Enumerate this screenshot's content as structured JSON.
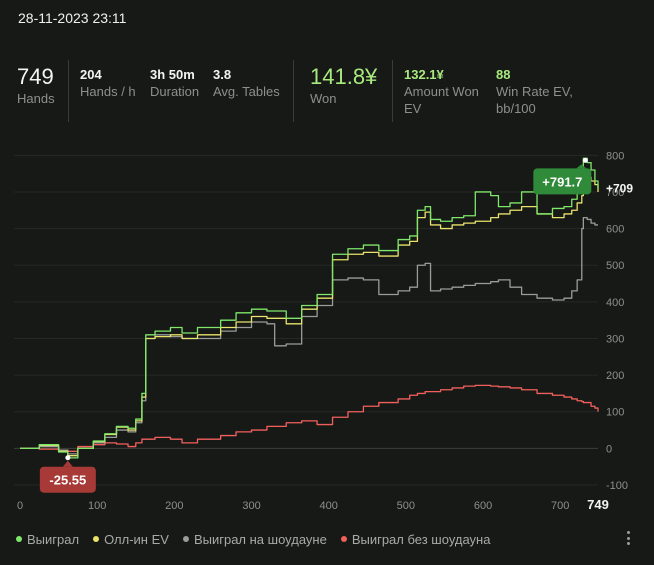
{
  "header": {
    "datetime": "28-11-2023 23:11"
  },
  "stats": {
    "hands": {
      "value": "749",
      "label": "Hands"
    },
    "hands_per_hour": {
      "value": "204",
      "label": "Hands / h"
    },
    "duration": {
      "value": "3h 50m",
      "label": "Duration"
    },
    "avg_tables": {
      "value": "3.8",
      "label": "Avg. Tables"
    },
    "won": {
      "value": "141.8¥",
      "label": "Won"
    },
    "amount_won_ev": {
      "value": "132.1¥",
      "label_line1": "Amount Won",
      "label_line2": "EV"
    },
    "win_rate_ev": {
      "value": "88",
      "label_line1": "Win Rate EV,",
      "label_line2": "bb/100"
    }
  },
  "legend": [
    {
      "name": "Выиграл",
      "color": "#7fe86a"
    },
    {
      "name": "Олл-ин EV",
      "color": "#e8e36a"
    },
    {
      "name": "Выиграл на шоудауне",
      "color": "#9a9c9a"
    },
    {
      "name": "Выиграл без шоудауна",
      "color": "#f2605c"
    }
  ],
  "chart_data": {
    "type": "line",
    "xlim": [
      0,
      749
    ],
    "ylim": [
      -100,
      820
    ],
    "x_ticks": [
      0,
      100,
      200,
      300,
      400,
      500,
      600,
      700
    ],
    "x_end_label": "749",
    "y_ticks": [
      -100,
      0,
      100,
      200,
      300,
      400,
      500,
      600,
      700,
      800
    ],
    "grid": "horizontal",
    "annotations": {
      "max": {
        "label": "+791.7",
        "x": 730,
        "y": 791.7
      },
      "min": {
        "label": "-25.55",
        "x": 62,
        "y": -25.55
      },
      "end": {
        "label": "+709",
        "y": 709
      }
    },
    "series": [
      {
        "name": "Выиграл",
        "color": "#7fe86a",
        "points": [
          [
            0,
            0
          ],
          [
            25,
            10
          ],
          [
            50,
            -10
          ],
          [
            62,
            -26
          ],
          [
            75,
            0
          ],
          [
            95,
            20
          ],
          [
            110,
            40
          ],
          [
            125,
            60
          ],
          [
            140,
            55
          ],
          [
            150,
            80
          ],
          [
            158,
            150
          ],
          [
            163,
            310
          ],
          [
            175,
            320
          ],
          [
            195,
            330
          ],
          [
            210,
            315
          ],
          [
            230,
            330
          ],
          [
            260,
            350
          ],
          [
            280,
            370
          ],
          [
            300,
            380
          ],
          [
            320,
            375
          ],
          [
            345,
            355
          ],
          [
            365,
            390
          ],
          [
            385,
            420
          ],
          [
            405,
            530
          ],
          [
            425,
            545
          ],
          [
            445,
            555
          ],
          [
            465,
            540
          ],
          [
            490,
            570
          ],
          [
            505,
            580
          ],
          [
            515,
            650
          ],
          [
            525,
            660
          ],
          [
            532,
            625
          ],
          [
            545,
            620
          ],
          [
            560,
            630
          ],
          [
            575,
            635
          ],
          [
            590,
            700
          ],
          [
            610,
            690
          ],
          [
            620,
            660
          ],
          [
            635,
            670
          ],
          [
            650,
            700
          ],
          [
            670,
            640
          ],
          [
            690,
            655
          ],
          [
            705,
            660
          ],
          [
            715,
            680
          ],
          [
            722,
            700
          ],
          [
            728,
            720
          ],
          [
            730,
            792
          ],
          [
            735,
            780
          ],
          [
            740,
            760
          ],
          [
            745,
            730
          ],
          [
            749,
            709
          ]
        ]
      },
      {
        "name": "Олл-ин EV",
        "color": "#e8e36a",
        "points": [
          [
            0,
            0
          ],
          [
            25,
            8
          ],
          [
            50,
            -8
          ],
          [
            62,
            -20
          ],
          [
            75,
            0
          ],
          [
            95,
            18
          ],
          [
            110,
            38
          ],
          [
            125,
            58
          ],
          [
            140,
            50
          ],
          [
            150,
            75
          ],
          [
            158,
            140
          ],
          [
            163,
            300
          ],
          [
            175,
            305
          ],
          [
            195,
            310
          ],
          [
            210,
            300
          ],
          [
            230,
            310
          ],
          [
            260,
            330
          ],
          [
            280,
            345
          ],
          [
            300,
            360
          ],
          [
            320,
            355
          ],
          [
            345,
            340
          ],
          [
            365,
            380
          ],
          [
            385,
            410
          ],
          [
            405,
            515
          ],
          [
            425,
            530
          ],
          [
            445,
            535
          ],
          [
            465,
            525
          ],
          [
            490,
            555
          ],
          [
            505,
            565
          ],
          [
            515,
            630
          ],
          [
            525,
            645
          ],
          [
            532,
            610
          ],
          [
            545,
            600
          ],
          [
            560,
            610
          ],
          [
            575,
            615
          ],
          [
            590,
            620
          ],
          [
            610,
            630
          ],
          [
            620,
            640
          ],
          [
            635,
            650
          ],
          [
            650,
            660
          ],
          [
            670,
            640
          ],
          [
            690,
            630
          ],
          [
            705,
            640
          ],
          [
            715,
            650
          ],
          [
            722,
            670
          ],
          [
            728,
            690
          ],
          [
            730,
            760
          ],
          [
            735,
            740
          ],
          [
            740,
            730
          ],
          [
            745,
            720
          ],
          [
            749,
            700
          ]
        ]
      },
      {
        "name": "Выиграл на шоудауне",
        "color": "#9a9c9a",
        "points": [
          [
            0,
            0
          ],
          [
            25,
            5
          ],
          [
            50,
            -5
          ],
          [
            62,
            -15
          ],
          [
            75,
            0
          ],
          [
            95,
            15
          ],
          [
            110,
            30
          ],
          [
            125,
            50
          ],
          [
            140,
            45
          ],
          [
            150,
            70
          ],
          [
            158,
            130
          ],
          [
            163,
            300
          ],
          [
            175,
            310
          ],
          [
            195,
            305
          ],
          [
            210,
            300
          ],
          [
            230,
            300
          ],
          [
            260,
            320
          ],
          [
            280,
            330
          ],
          [
            300,
            345
          ],
          [
            320,
            340
          ],
          [
            330,
            280
          ],
          [
            345,
            285
          ],
          [
            365,
            360
          ],
          [
            385,
            390
          ],
          [
            405,
            460
          ],
          [
            425,
            465
          ],
          [
            445,
            460
          ],
          [
            465,
            420
          ],
          [
            490,
            430
          ],
          [
            505,
            440
          ],
          [
            515,
            500
          ],
          [
            525,
            505
          ],
          [
            532,
            430
          ],
          [
            545,
            435
          ],
          [
            560,
            440
          ],
          [
            575,
            445
          ],
          [
            590,
            450
          ],
          [
            610,
            455
          ],
          [
            620,
            460
          ],
          [
            635,
            440
          ],
          [
            650,
            420
          ],
          [
            670,
            410
          ],
          [
            690,
            405
          ],
          [
            705,
            410
          ],
          [
            715,
            430
          ],
          [
            722,
            460
          ],
          [
            728,
            600
          ],
          [
            730,
            630
          ],
          [
            735,
            625
          ],
          [
            740,
            615
          ],
          [
            745,
            610
          ],
          [
            749,
            610
          ]
        ]
      },
      {
        "name": "Выиграл без шоудауна",
        "color": "#f2605c",
        "points": [
          [
            0,
            0
          ],
          [
            25,
            -2
          ],
          [
            50,
            -5
          ],
          [
            62,
            -8
          ],
          [
            75,
            5
          ],
          [
            95,
            10
          ],
          [
            110,
            15
          ],
          [
            125,
            12
          ],
          [
            140,
            5
          ],
          [
            150,
            15
          ],
          [
            158,
            25
          ],
          [
            175,
            30
          ],
          [
            195,
            25
          ],
          [
            210,
            15
          ],
          [
            230,
            25
          ],
          [
            260,
            35
          ],
          [
            280,
            45
          ],
          [
            300,
            50
          ],
          [
            320,
            60
          ],
          [
            345,
            70
          ],
          [
            365,
            75
          ],
          [
            385,
            65
          ],
          [
            405,
            85
          ],
          [
            425,
            100
          ],
          [
            445,
            115
          ],
          [
            465,
            125
          ],
          [
            490,
            135
          ],
          [
            505,
            145
          ],
          [
            515,
            150
          ],
          [
            525,
            155
          ],
          [
            545,
            160
          ],
          [
            560,
            165
          ],
          [
            575,
            170
          ],
          [
            590,
            172
          ],
          [
            610,
            170
          ],
          [
            620,
            168
          ],
          [
            635,
            165
          ],
          [
            650,
            160
          ],
          [
            670,
            150
          ],
          [
            690,
            145
          ],
          [
            705,
            140
          ],
          [
            715,
            135
          ],
          [
            722,
            130
          ],
          [
            728,
            128
          ],
          [
            730,
            125
          ],
          [
            735,
            125
          ],
          [
            740,
            115
          ],
          [
            745,
            110
          ],
          [
            749,
            100
          ]
        ]
      }
    ]
  }
}
